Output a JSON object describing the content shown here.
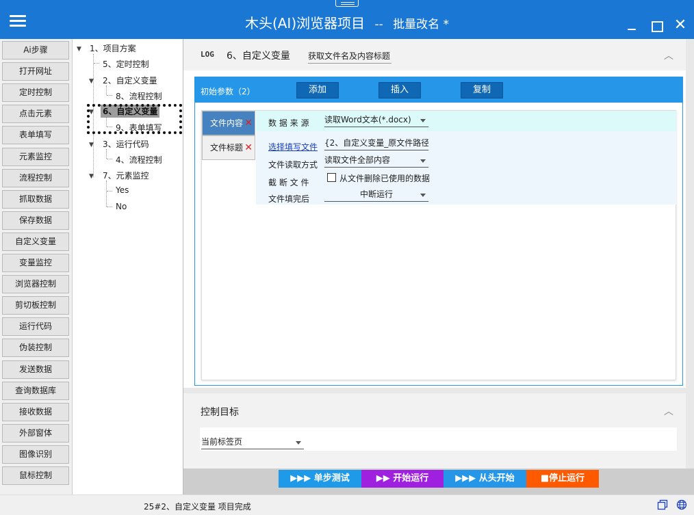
{
  "window": {
    "title": "木头(AI)浏览器项目",
    "separator": "--",
    "subtitle": "批量改名 *"
  },
  "leftButtons": [
    "Ai步骤",
    "打开网址",
    "定时控制",
    "点击元素",
    "表单填写",
    "元素监控",
    "流程控制",
    "抓取数据",
    "保存数据",
    "自定义变量",
    "变量监控",
    "浏览器控制",
    "剪切板控制",
    "运行代码",
    "伪装控制",
    "发送数据",
    "查询数据库",
    "接收数据",
    "外部窗体",
    "图像识别",
    "鼠标控制"
  ],
  "tree": {
    "n1": "1、项目方案",
    "n5": "5、定时控制",
    "n2": "2、自定义变量",
    "n8": "8、流程控制",
    "n6": "6、自定义变量",
    "n9": "9、表单填写",
    "n3": "3、运行代码",
    "n4": "4、流程控制",
    "n7": "7、元素监控",
    "yes": "Yes",
    "no": "No"
  },
  "step": {
    "log": "LOG",
    "title": "6、自定义变量",
    "desc": "获取文件名及内容标题"
  },
  "params": {
    "label": "初始参数（2）",
    "add": "添加",
    "insert": "插入",
    "copy": "复制"
  },
  "tabs": {
    "tab1": "文件内容",
    "tab2": "文件标题",
    "close": "✕"
  },
  "fields": {
    "source_label": "数 据 来 源",
    "source_value": "读取Word文本(*.docx)",
    "pick_label": "选择填写文件",
    "pick_value": "{2、自定义变量_原文件路径",
    "mode_label": "文件读取方式",
    "mode_value": "读取文件全部内容",
    "cut_label": "截 断 文 件",
    "cut_check": "从文件删除已使用的数据",
    "after_label": "文件填完后",
    "after_value": "中断运行"
  },
  "control": {
    "title": "控制目标",
    "target": "当前标签页"
  },
  "run": {
    "step": "▶▶▶ 单步测试",
    "start": "▶▶ 开始运行",
    "restart": "▶▶▶ 从头开始",
    "stop": "■停止运行"
  },
  "colors": {
    "titlebar": "#1a78d4",
    "step": "#1e9ae8",
    "start": "#a020e0",
    "restart": "#2596e8",
    "stop": "#ff5a00"
  },
  "status": {
    "text": "25#2、自定义变量 项目完成"
  }
}
